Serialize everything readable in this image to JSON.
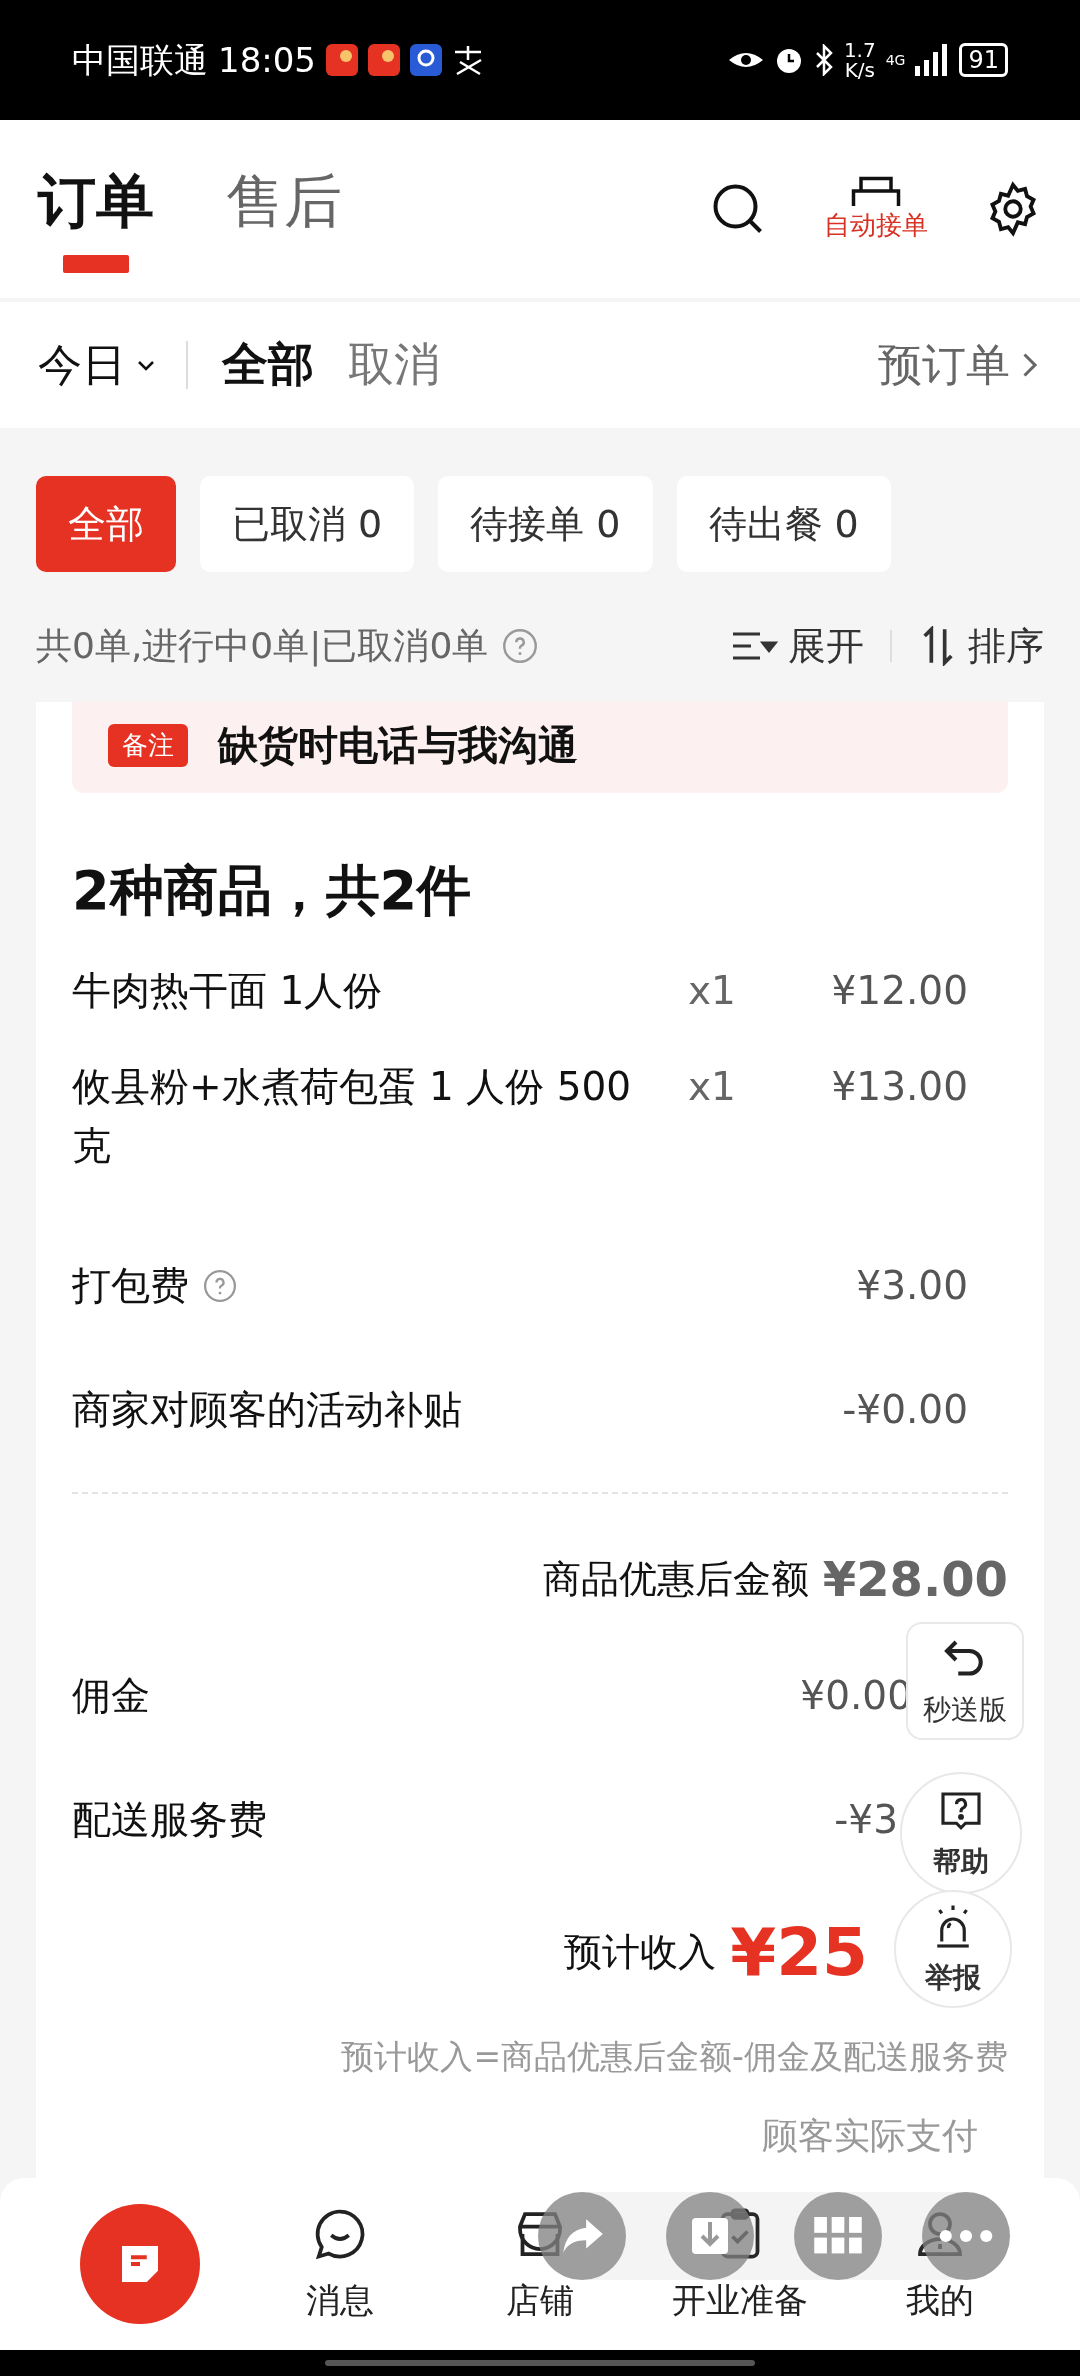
{
  "status_bar": {
    "carrier": "中国联通",
    "time": "18:05",
    "speed_value": "1.7",
    "speed_unit": "K/s",
    "network": "4G",
    "battery": "91"
  },
  "tabs": [
    {
      "label": "订单",
      "selected": true
    },
    {
      "label": "售后",
      "selected": false
    }
  ],
  "toolbar": {
    "auto_accept": "自动接单"
  },
  "filter_bar": {
    "date": "今日",
    "views": [
      {
        "label": "全部",
        "selected": true
      },
      {
        "label": "取消",
        "selected": false
      }
    ],
    "preorder": "预订单"
  },
  "chips": [
    {
      "label": "全部",
      "selected": true
    },
    {
      "label": "已取消 0",
      "selected": false
    },
    {
      "label": "待接单 0",
      "selected": false
    },
    {
      "label": "待出餐 0",
      "selected": false
    }
  ],
  "summary": {
    "text": "共0单,进行中0单|已取消0单",
    "expand": "展开",
    "sort": "排序"
  },
  "order": {
    "note_badge": "备注",
    "note": "缺货时电话与我沟通",
    "goods_title": "2种商品，共2件",
    "items": [
      {
        "name": "牛肉热干面 1人份",
        "qty": "x1",
        "price": "¥12.00"
      },
      {
        "name": "攸县粉+水煮荷包蛋 1 人份 500 克",
        "qty": "x1",
        "price": "¥13.00"
      }
    ],
    "fees": [
      {
        "label": "打包费",
        "help": true,
        "amount": "¥3.00"
      },
      {
        "label": "商家对顾客的活动补贴",
        "help": false,
        "amount": "-¥0.00"
      }
    ],
    "subtotal_label": "商品优惠后金额",
    "subtotal": "¥28.00",
    "deductions": [
      {
        "label": "佣金",
        "amount": "¥0.00"
      },
      {
        "label": "配送服务费",
        "amount": "-¥3"
      }
    ],
    "income_label": "预计收入",
    "income": "¥25",
    "formula": "预计收入=商品优惠后金额-佣金及配送服务费",
    "paid_label": "顾客实际支付"
  },
  "floating": [
    {
      "kind": "undo",
      "label": "秒送版"
    },
    {
      "kind": "help",
      "label": "帮助"
    },
    {
      "kind": "alarm",
      "label": "举报"
    }
  ],
  "nav": [
    {
      "kind": "orders",
      "selected": true
    },
    {
      "kind": "message",
      "label": "消息",
      "selected": false
    },
    {
      "kind": "store",
      "label": "店铺",
      "selected": false
    },
    {
      "kind": "checklist",
      "label": "开业准备",
      "selected": false
    },
    {
      "kind": "profile",
      "label": "我的",
      "selected": false
    }
  ]
}
